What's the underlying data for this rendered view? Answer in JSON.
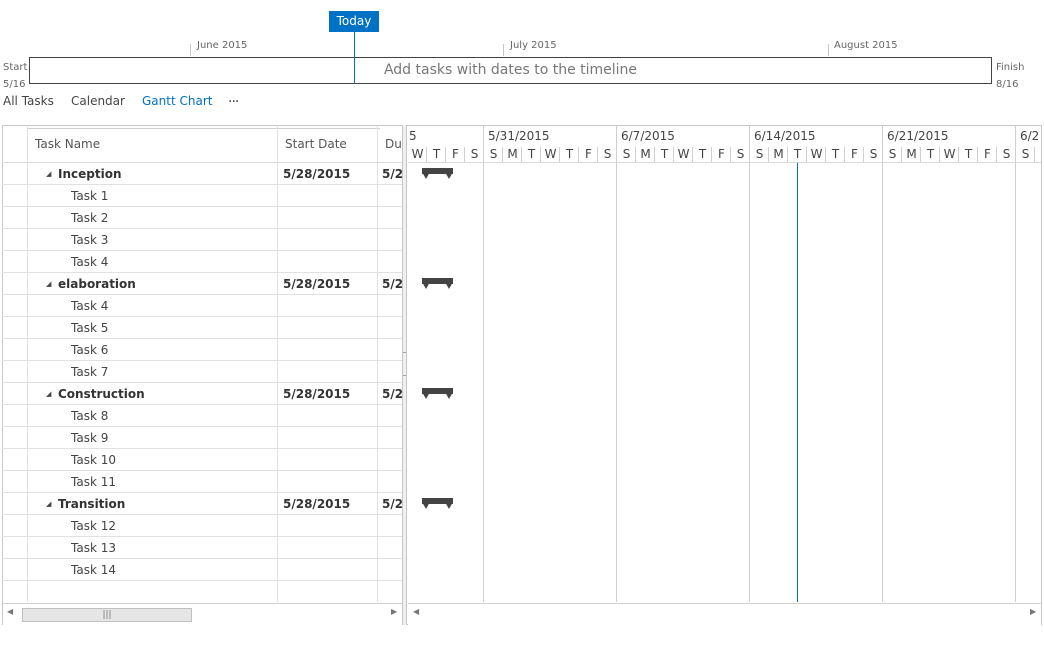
{
  "timeline": {
    "today_label": "Today",
    "months": [
      "June 2015",
      "July 2015",
      "August 2015"
    ],
    "placeholder": "Add tasks with dates to the timeline",
    "start_label": "Start",
    "start_date": "5/16",
    "finish_label": "Finish",
    "finish_date": "8/16"
  },
  "views": {
    "all_tasks": "All Tasks",
    "calendar": "Calendar",
    "gantt_chart": "Gantt Chart",
    "more": "···",
    "active": "Gantt Chart"
  },
  "grid": {
    "columns": {
      "task_name": "Task Name",
      "start_date": "Start Date",
      "duration": "Du"
    },
    "rows": [
      {
        "name": "Inception",
        "summary": true,
        "start": "5/28/2015",
        "due": "5/2"
      },
      {
        "name": "Task 1",
        "summary": false,
        "start": "",
        "due": ""
      },
      {
        "name": "Task 2",
        "summary": false,
        "start": "",
        "due": ""
      },
      {
        "name": "Task 3",
        "summary": false,
        "start": "",
        "due": ""
      },
      {
        "name": "Task 4",
        "summary": false,
        "start": "",
        "due": ""
      },
      {
        "name": "elaboration",
        "summary": true,
        "start": "5/28/2015",
        "due": "5/2"
      },
      {
        "name": "Task 4",
        "summary": false,
        "start": "",
        "due": ""
      },
      {
        "name": "Task 5",
        "summary": false,
        "start": "",
        "due": ""
      },
      {
        "name": "Task 6",
        "summary": false,
        "start": "",
        "due": ""
      },
      {
        "name": "Task 7",
        "summary": false,
        "start": "",
        "due": ""
      },
      {
        "name": "Construction",
        "summary": true,
        "start": "5/28/2015",
        "due": "5/2"
      },
      {
        "name": "Task 8",
        "summary": false,
        "start": "",
        "due": ""
      },
      {
        "name": "Task 9",
        "summary": false,
        "start": "",
        "due": ""
      },
      {
        "name": "Task 10",
        "summary": false,
        "start": "",
        "due": ""
      },
      {
        "name": "Task 11",
        "summary": false,
        "start": "",
        "due": ""
      },
      {
        "name": "Transition",
        "summary": true,
        "start": "5/28/2015",
        "due": "5/2"
      },
      {
        "name": "Task 12",
        "summary": false,
        "start": "",
        "due": ""
      },
      {
        "name": "Task 13",
        "summary": false,
        "start": "",
        "due": ""
      },
      {
        "name": "Task 14",
        "summary": false,
        "start": "",
        "due": ""
      }
    ]
  },
  "gantt": {
    "partial_week_label": "5",
    "weeks": [
      "5/31/2015",
      "6/7/2015",
      "6/14/2015",
      "6/21/2015",
      "6/2"
    ],
    "partial_days": [
      "W",
      "T",
      "F",
      "S"
    ],
    "week_days": [
      "S",
      "M",
      "T",
      "W",
      "T",
      "F",
      "S"
    ],
    "trailing_days": [
      "S",
      "S"
    ],
    "today_date": "6/16/2015"
  },
  "colors": {
    "accent": "#0072c6",
    "bar": "#444444"
  },
  "scroll": {
    "left_arrow": "◀",
    "right_arrow": "▶",
    "thumb_grip": "|||"
  }
}
